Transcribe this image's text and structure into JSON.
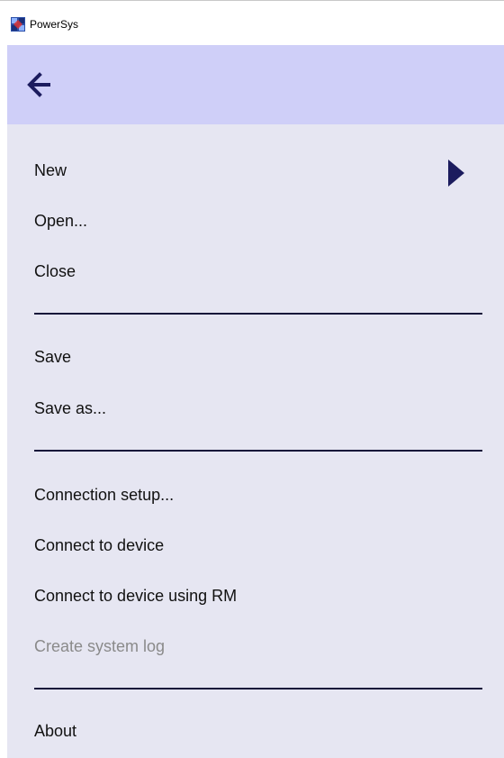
{
  "app": {
    "title": "PowerSys",
    "icon": "powersys-app-icon"
  },
  "header": {
    "back_icon": "arrow-left-icon"
  },
  "menu": {
    "items": [
      {
        "label": "New",
        "has_submenu": true,
        "enabled": true
      },
      {
        "label": "Open...",
        "enabled": true
      },
      {
        "label": "Close",
        "enabled": true
      },
      {
        "label": "Save",
        "enabled": true
      },
      {
        "label": "Save as...",
        "enabled": true
      },
      {
        "label": "Connection setup...",
        "enabled": true
      },
      {
        "label": "Connect to device",
        "enabled": true
      },
      {
        "label": "Connect to device using RM",
        "enabled": true
      },
      {
        "label": "Create system log",
        "enabled": false
      },
      {
        "label": "About",
        "enabled": true
      }
    ],
    "submenu_icon": "triangle-right-icon"
  },
  "colors": {
    "header_bg": "#cfcff8",
    "panel_bg": "#e6e6f2",
    "divider": "#16163a",
    "accent_dark": "#1c1c5e",
    "disabled_text": "#8a8a8a"
  }
}
